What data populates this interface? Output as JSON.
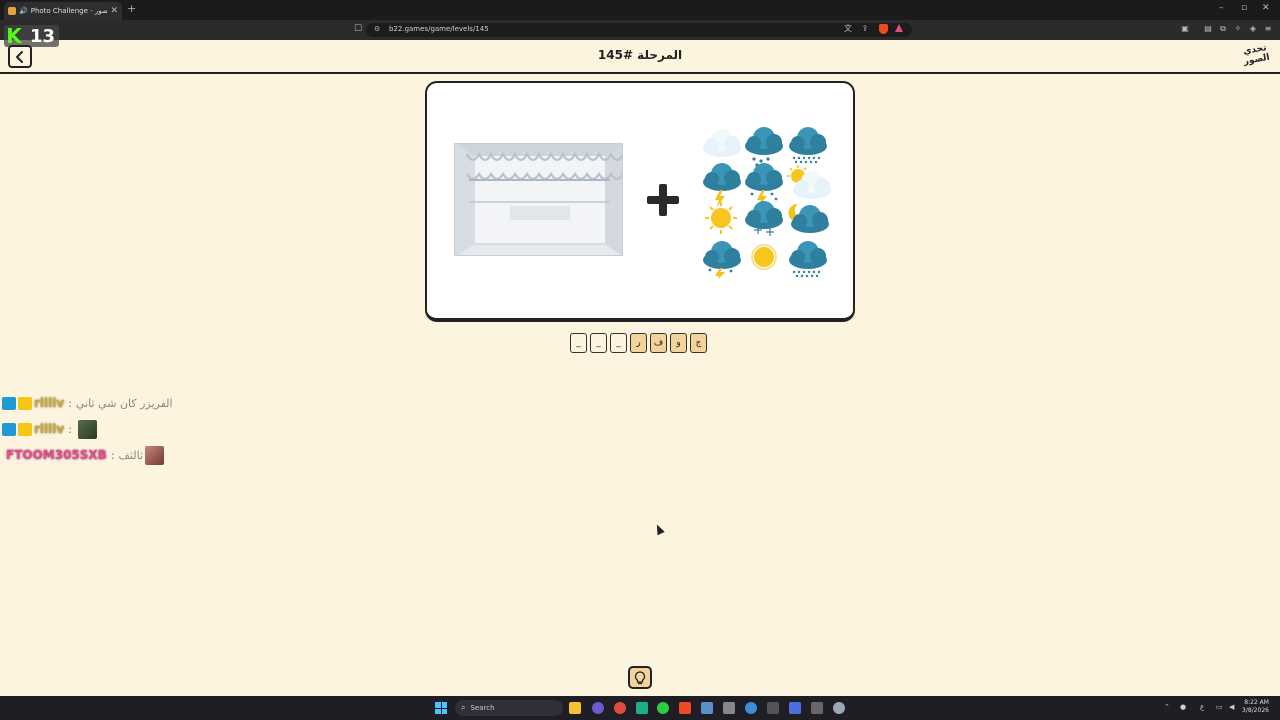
{
  "browser": {
    "tab_title": "Photo Challenge - تحدي الصور",
    "new_tab_icon": "+",
    "url": "b22.games/game/levels/145"
  },
  "kick_overlay": {
    "k": "K",
    "number": "13"
  },
  "header": {
    "title": "المرحلة #145",
    "logo_text": "تحدي الصور"
  },
  "puzzle": {
    "images": [
      "freezer-photo",
      "weather-icons-grid"
    ],
    "operator": "plus-icon"
  },
  "answer": {
    "slots": [
      "_",
      "_",
      "_",
      "ر",
      "ف",
      "و",
      "ج"
    ],
    "filled": [
      false,
      false,
      false,
      true,
      true,
      true,
      true
    ]
  },
  "chat": [
    {
      "username": "rllllv",
      "separator": ":",
      "text": "الفريزر كان شي ثاني",
      "badges": [
        "mod",
        "sub"
      ],
      "color": "#c9a84a"
    },
    {
      "username": "rllllv",
      "separator": ":",
      "text": "",
      "badges": [
        "mod",
        "sub"
      ],
      "color": "#c9a84a"
    },
    {
      "username": "FTOOM305SXB",
      "separator": ":",
      "text": "ثالثف",
      "badges": [],
      "color": "#e0508e"
    }
  ],
  "taskbar": {
    "search_label": "Search",
    "time": "8:22 AM",
    "date": "3/8/2026"
  },
  "colors": {
    "page_background": "#fcf4df",
    "hint_button": "#f2d49a",
    "kick_green": "#53fc18"
  }
}
